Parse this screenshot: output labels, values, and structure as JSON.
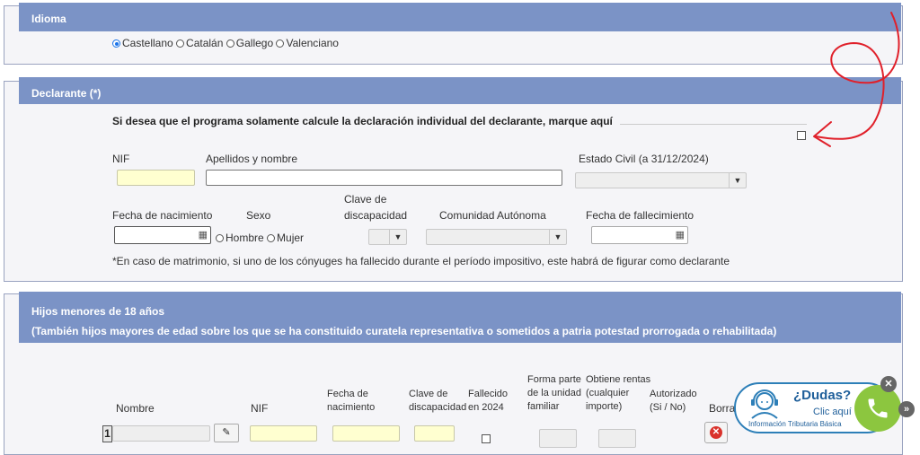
{
  "idioma": {
    "title": "Idioma",
    "options": [
      "Castellano",
      "Catalán",
      "Gallego",
      "Valenciano"
    ],
    "selected": "Castellano"
  },
  "declarante": {
    "title": "Declarante (*)",
    "individual_text": "Si desea que el programa solamente calcule la declaración individual del declarante, marque aquí",
    "nif_label": "NIF",
    "apellidos_label": "Apellidos y nombre",
    "estado_civil_label": "Estado Civil (a 31/12/2024)",
    "fecha_nac_label": "Fecha de nacimiento",
    "sexo_label": "Sexo",
    "clave_disc_label_1": "Clave de",
    "clave_disc_label_2": "discapacidad",
    "comunidad_label": "Comunidad Autónoma",
    "fecha_fall_label": "Fecha de fallecimiento",
    "hombre": "Hombre",
    "mujer": "Mujer",
    "note": "*En caso de matrimonio, si uno de los cónyuges ha fallecido durante el período impositivo, este habrá de figurar como declarante"
  },
  "hijos": {
    "title": "Hijos menores de 18 años",
    "subtitle": "(También hijos mayores de edad sobre los que se ha constituido curatela representativa o sometidos a patria potestad prorrogada o rehabilitada)",
    "cols": {
      "nombre": "Nombre",
      "nif": "NIF",
      "fecha_nac_1": "Fecha de",
      "fecha_nac_2": "nacimiento",
      "clave_1": "Clave de",
      "clave_2": "discapacidad",
      "fallecido_1": "Fallecido",
      "fallecido_2": "en 2024",
      "forma_1": "Forma parte",
      "forma_2": "de la unidad",
      "forma_3": "familiar",
      "obtiene_1": "Obtiene rentas",
      "obtiene_2": "(cualquier",
      "obtiene_3": "importe)",
      "autorizado_1": "Autorizado",
      "autorizado_2": "(Si / No)",
      "borrar": "Borra"
    },
    "row_number": "1"
  },
  "dudas": {
    "title": "¿Dudas?",
    "clic": "Clic aquí",
    "info": "Información Tributaria Básica"
  },
  "colors": {
    "header_bg": "#7b93c6",
    "required_field": "#ffffd0",
    "annotation": "#e0202a",
    "phone_green": "#8cc63f"
  }
}
